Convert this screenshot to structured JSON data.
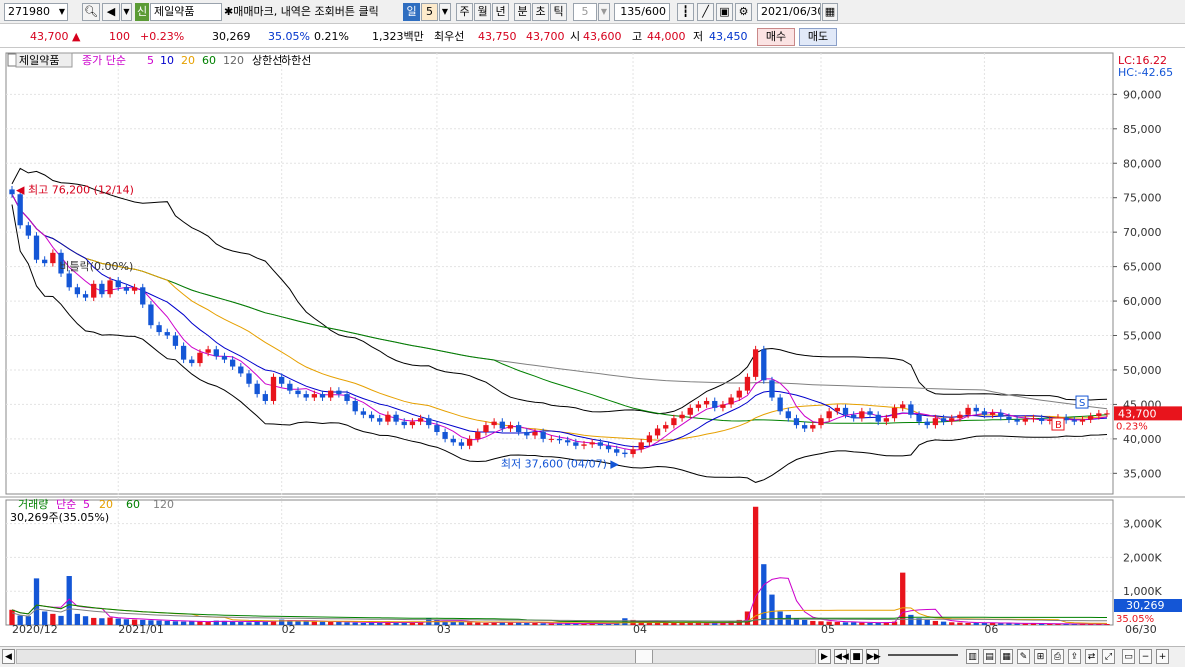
{
  "toolbar": {
    "code": "271980",
    "new_badge": "신",
    "stock_name": "제일약품",
    "hint": "✱매매마크, 내역은 조회버튼 클릭",
    "periods": [
      "일",
      "주",
      "월",
      "년",
      "분",
      "초",
      "틱"
    ],
    "period_count": "5",
    "tick_value": "5",
    "count": "135/600",
    "date": "2021/06/30",
    "active_period": "일"
  },
  "quote": {
    "price": "43,700 ▲",
    "change": "100",
    "change_pct": "+0.23%",
    "volume": "30,269",
    "volume_ratio": "35.05%",
    "turnover": "0.21%",
    "amount": "1,323백만",
    "best_label": "최우선",
    "best_ask": "43,750",
    "best_bid": "43,700",
    "open_label": "시",
    "open": "43,600",
    "high_label": "고",
    "high": "44,000",
    "low_label": "저",
    "low": "43,450",
    "buy_label": "매수",
    "sell_label": "매도"
  },
  "chart_data": [
    {
      "type": "candlestick",
      "title": "제일약품",
      "legend": [
        "종가 단순",
        "5",
        "10",
        "20",
        "60",
        "120",
        "상한선",
        "하한선"
      ],
      "legend_colors": {
        "5": "#cc00cc",
        "10": "#0000cc",
        "20": "#e6a000",
        "60": "#008000",
        "120": "#808080",
        "upper": "#000000",
        "lower": "#000000"
      },
      "lc_label": "LC:16.22",
      "hc_label": "HC:-42.65",
      "ylim": [
        32000,
        96000
      ],
      "y_ticks": [
        35000,
        40000,
        45000,
        50000,
        55000,
        60000,
        65000,
        70000,
        75000,
        80000,
        85000,
        90000
      ],
      "y_tick_labels": [
        "35,000",
        "40,000",
        "45,000",
        "50,000",
        "55,000",
        "60,000",
        "65,000",
        "70,000",
        "75,000",
        "80,000",
        "85,000",
        "90,000"
      ],
      "x_labels": [
        "2020/12",
        "2021/01",
        "02",
        "03",
        "04",
        "05",
        "06",
        "06/30"
      ],
      "x_label_index": [
        0,
        13,
        33,
        52,
        76,
        99,
        119,
        135
      ],
      "annotations": {
        "high": "최고 76,200 (12/14)",
        "low": "최저 37,600 (04/07)",
        "ratio": "비틀락(0.00%)",
        "current_price": "43,700",
        "current_pct": "0.23%",
        "mark_s": "S",
        "mark_b": "B"
      },
      "close": [
        75500,
        71000,
        69500,
        66000,
        65500,
        67000,
        64000,
        62000,
        61000,
        60500,
        62500,
        61000,
        63000,
        62000,
        61500,
        62000,
        59500,
        56500,
        55500,
        55000,
        53500,
        51500,
        51000,
        52500,
        53000,
        52000,
        51500,
        50500,
        49500,
        48000,
        46500,
        45500,
        49000,
        48000,
        47000,
        46500,
        46000,
        46500,
        46000,
        47000,
        46500,
        45500,
        44000,
        43500,
        43000,
        42500,
        43500,
        42500,
        42000,
        42500,
        43000,
        42000,
        41000,
        40000,
        39500,
        39000,
        40000,
        41000,
        42000,
        42500,
        41500,
        42000,
        41000,
        40500,
        41000,
        40000,
        40000,
        39800,
        39500,
        39000,
        39200,
        39500,
        39000,
        38500,
        38000,
        37800,
        38500,
        39500,
        40500,
        41500,
        42000,
        43000,
        43500,
        44500,
        45000,
        45500,
        44500,
        45000,
        46000,
        47000,
        49000,
        53000,
        48500,
        46000,
        44000,
        43000,
        42000,
        41500,
        42000,
        43000,
        44000,
        44500,
        43500,
        43000,
        44000,
        43500,
        42500,
        43000,
        44500,
        45000,
        43500,
        42500,
        42000,
        43000,
        42500,
        43000,
        43500,
        44500,
        44000,
        43500,
        43800,
        43200,
        42800,
        42500,
        42900,
        43000,
        42600,
        42800,
        43100,
        42700,
        42500,
        42800,
        43300,
        43700,
        43700
      ],
      "volume_unit": "K",
      "volume": [
        450,
        280,
        260,
        1380,
        400,
        330,
        270,
        1450,
        330,
        260,
        210,
        200,
        220,
        190,
        170,
        160,
        150,
        140,
        130,
        120,
        110,
        100,
        110,
        100,
        90,
        130,
        120,
        100,
        90,
        80,
        130,
        110,
        120,
        160,
        140,
        120,
        110,
        100,
        100,
        90,
        100,
        80,
        70,
        60,
        70,
        80,
        90,
        70,
        60,
        70,
        80,
        200,
        150,
        110,
        100,
        90,
        80,
        70,
        60,
        70,
        100,
        90,
        70,
        60,
        60,
        50,
        40,
        40,
        50,
        40,
        40,
        50,
        40,
        40,
        60,
        200,
        150,
        90,
        110,
        90,
        80,
        70,
        60,
        70,
        60,
        50,
        60,
        70,
        100,
        150,
        400,
        3500,
        1800,
        900,
        400,
        300,
        200,
        150,
        120,
        110,
        100,
        90,
        80,
        80,
        70,
        60,
        70,
        80,
        100,
        1550,
        300,
        200,
        150,
        120,
        100,
        80,
        70,
        60,
        60,
        70,
        60,
        50,
        50,
        40,
        40,
        50,
        40,
        30,
        30,
        40,
        30,
        40,
        30,
        30,
        30
      ],
      "volume_ticks": [
        1000,
        2000,
        3000
      ],
      "volume_tick_labels": [
        "1,000K",
        "2,000K",
        "3,000K"
      ],
      "volume_ylim": [
        0,
        3700
      ],
      "volume_legend": [
        "거래량",
        "단순",
        "5",
        "20",
        "60",
        "120"
      ],
      "volume_legend_colors": [
        "#008000",
        "#cc00cc",
        "#cc00cc",
        "#e6a000",
        "#008000",
        "#808080"
      ],
      "volume_info": "30,269주(35.05%)",
      "volume_current": "30,269",
      "volume_current_pct": "35.05%"
    }
  ]
}
